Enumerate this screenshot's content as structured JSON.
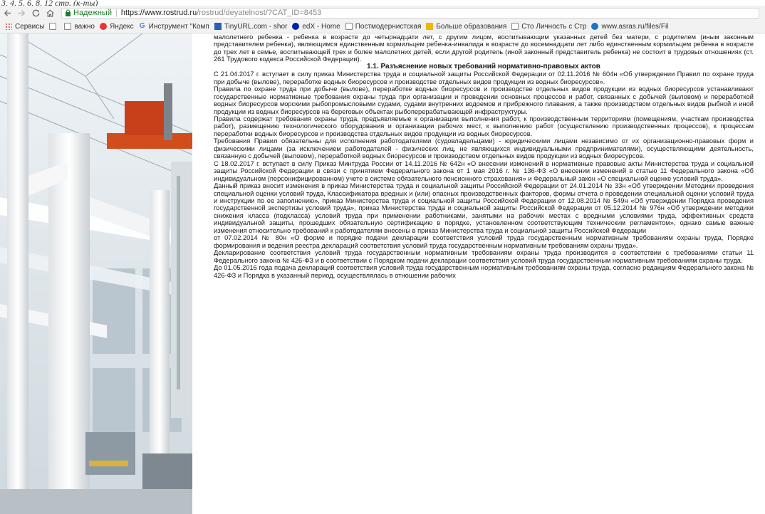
{
  "browser": {
    "top_fragment": "3, 4, 5, 6, 8, 12 стр. (к-ты)",
    "secure_label": "Надежный",
    "url_host": "https://www.rostrud.ru",
    "url_path": "/rostrud/deyatelnost/?CAT_ID=8453"
  },
  "bookmarks": [
    {
      "icon": "apps-icon",
      "label": "Сервисы"
    },
    {
      "icon": "page-icon",
      "label": ""
    },
    {
      "icon": "page-icon",
      "label": "важно"
    },
    {
      "icon": "yandex-icon",
      "label": "Яндекс"
    },
    {
      "icon": "google-icon",
      "label": "Инструмент \"Комп"
    },
    {
      "icon": "tinyurl-icon",
      "label": "TinyURL.com - shor"
    },
    {
      "icon": "edx-icon",
      "label": "edX - Home"
    },
    {
      "icon": "page-icon",
      "label": "Постмодернистская"
    },
    {
      "icon": "hse-icon",
      "label": "Больше образования"
    },
    {
      "icon": "page-icon",
      "label": "Сто Личность с Стр"
    },
    {
      "icon": "aksaras-icon",
      "label": "www.asras.ru/files/Fil"
    }
  ],
  "document": {
    "para_intro": "малолетнего ребенка - ребенка в возрасте до четырнадцати лет, с другим лицом, воспитывающим указанных детей без матери, с родителем (иным законным представителем ребенка), являющимся единственным кормильцем ребенка-инвалида в возрасте до восемнадцати лет либо единственным кормильцем ребенка в возрасте до трех лет в семье, воспитывающей трех и более малолетних детей, если другой родитель (иной законный представитель ребенка) не состоит в трудовых отношениях (ст. 261 Трудового кодекса Российской Федерации).",
    "heading": "1.1. Разъяснение новых требований нормативно-правовых актов",
    "p1": "С 21.04.2017 г. вступает в силу приказ Министерства труда и социальной защиты Российской Федерации от 02.11.2016 № 604н «Об утверждении Правил по охране труда при добыче (вылове), переработке водных биоресурсов и производстве отдельных видов продукции из водных биоресурсов».",
    "p2": "Правила по охране труда при добыче (вылове), переработке водных биоресурсов и производстве отдельных видов продукции из водных биоресурсов устанавливают государственные нормативные требования охраны труда при организации и проведении основных процессов и работ, связанных с добычей (выловом) и переработкой водных биоресурсов морскими рыбопромысловыми судами, судами внутренних водоемов и прибрежного плавания, а также производством отдельных видов рыбной и иной продукции из водных биоресурсов на береговых объектах рыбоперерабатывающей инфраструктуры.",
    "p3": "Правила содержат требования охраны труда, предъявляемые к организации выполнения работ, к производственным территориям (помещениям, участкам производства работ), размещению технологического оборудования и организации рабочих мест, к выполнению работ (осуществлению производственных процессов), к процессам переработки водных биоресурсов и производства отдельных видов продукции из водных биоресурсов.",
    "p4": "Требования Правил обязательны для исполнения работодателями (судовладельцами) - юридическими лицами независимо от их организационно-правовых форм и физическими лицами (за исключением работодателей - физических лиц, не являющихся индивидуальными предпринимателями), осуществляющими деятельность, связанную с добычей (выловом), переработкой водных биоресурсов и производством отдельных видов продукции из водных биоресурсов.",
    "p5": "С 18.02.2017 г. вступает в силу Приказ Минтруда России от 14.11.2016 № 642н «О внесении изменений в нормативные правовые акты Министерства труда и социальной защиты Российской Федерации в связи с принятием Федерального закона от 1 мая 2016 г. № 136-ФЗ «О внесении изменений в статью 11 Федерального закона «Об индивидуальном (персонифицированном) учете в системе обязательного пенсионного страхования» и Федеральный закон «О специальной оценке условий труда».",
    "p6": "Данный приказ вносит изменения в приказ Министерства труда и социальной защиты Российской Федерации от 24.01.2014 № 33н «Об утверждении Методики проведения специальной оценки условий труда, Классификатора вредных и (или) опасных производственных факторов, формы отчета о проведении специальной оценки условий труда и инструкции по ее заполнению», приказ Министерства труда и социальной защиты Российской Федерации от 12.08.2014 № 549н «Об утверждении Порядка проведения государственной экспертизы условий труда», приказ Министерства труда и социальной защиты Российской Федерации от 05.12.2014 № 976н «Об утверждении методики снижения класса (подкласса) условий труда при применении работниками, занятыми на рабочих местах с вредными условиями труда, эффективных средств индивидуальной защиты, прошедших обязательную сертификацию в порядке, установленном соответствующим техническим регламентом», однако самые важные изменения относительно требований к работодателям внесены в приказ Министерства труда и социальной защиты Российской Федерации",
    "p7": "от 07.02.2014 № 80н «О форме и порядке подачи декларации соответствия условий труда государственным нормативным требованиям охраны труда, Порядке формирования и ведения реестра деклараций соответствия условий труда государственным нормативным требованиям охраны труда».",
    "p8": "Декларирование соответствия условий труда государственным нормативным требованиям охраны труда производится в соответствии с требованиями статьи 11 Федерального закона № 426-ФЗ и в соответствии с Порядком подачи декларации соответствия условий труда государственным нормативным требованиям охраны труда.",
    "p9": "До 01.05.2016 года подача деклараций соответствия условий труда государственным нормативным требованиям охраны труда, согласно редакциям Федерального закона № 426-ФЗ и Порядка в указанный период, осуществлялась в отношении рабочих"
  }
}
